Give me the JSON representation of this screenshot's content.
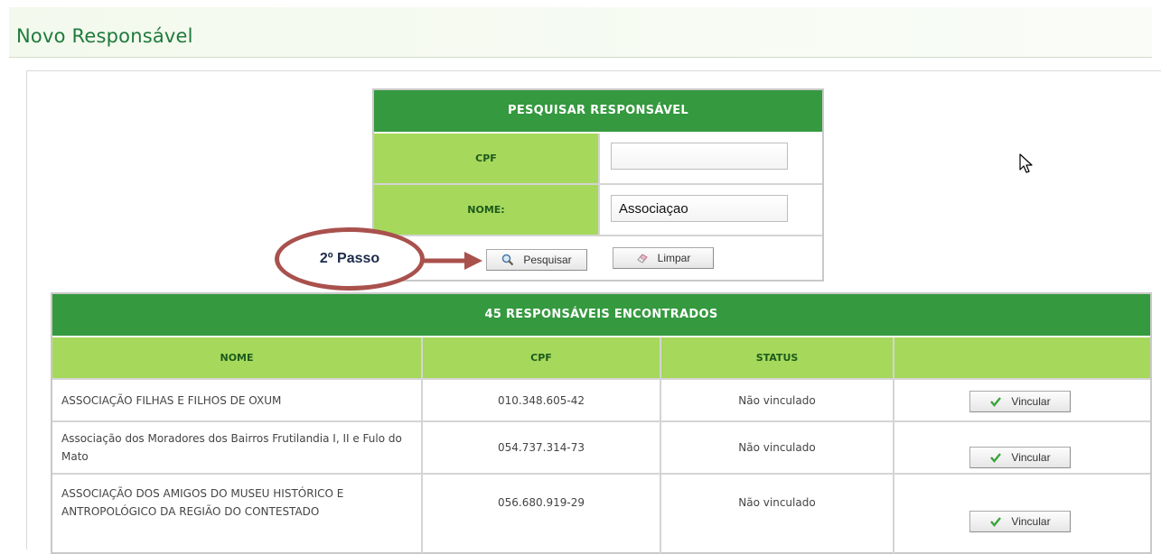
{
  "page": {
    "title": "Novo Responsável"
  },
  "search": {
    "header": "PESQUISAR RESPONSÁVEL",
    "cpf_label": "CPF",
    "cpf_value": "",
    "nome_label": "NOME:",
    "nome_value": "Associaçao",
    "search_button": "Pesquisar",
    "clear_button": "Limpar"
  },
  "annotation": {
    "step_label": "2º Passo"
  },
  "results": {
    "header": "45 RESPONSÁVEIS ENCONTRADOS",
    "columns": [
      "NOME",
      "CPF",
      "STATUS",
      ""
    ],
    "rows": [
      {
        "nome": "ASSOCIAÇÃO FILHAS E FILHOS DE OXUM",
        "cpf": "010.348.605-42",
        "status": "Não vinculado",
        "action": "Vincular"
      },
      {
        "nome": "Associação dos Moradores dos Bairros Frutilandia I, II e Fulo do Mato",
        "cpf": "054.737.314-73",
        "status": "Não vinculado",
        "action": "Vincular"
      },
      {
        "nome": "ASSOCIAÇÃO DOS AMIGOS DO MUSEU HISTÓRICO E ANTROPOLÓGICO DA REGIÃO DO CONTESTADO",
        "cpf": "056.680.919-29",
        "status": "Não vinculado",
        "action": "Vincular"
      }
    ]
  },
  "colors": {
    "header_green": "#35993f",
    "label_green": "#a6d95b",
    "title_green": "#1f7a3c",
    "callout_red": "#a9514d"
  }
}
